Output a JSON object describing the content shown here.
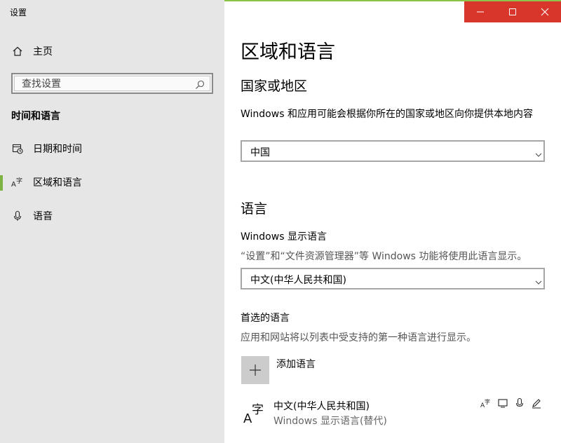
{
  "window": {
    "title": "设置"
  },
  "sidebar": {
    "home_label": "主页",
    "search_placeholder": "查找设置",
    "section_heading": "时间和语言",
    "items": [
      {
        "label": "日期和时间",
        "icon": "calendar-clock-icon"
      },
      {
        "label": "区域和语言",
        "icon": "language-icon",
        "selected": true
      },
      {
        "label": "语音",
        "icon": "microphone-icon"
      }
    ]
  },
  "main": {
    "title": "区域和语言",
    "country": {
      "heading": "国家或地区",
      "description": "Windows 和应用可能会根据你所在的国家或地区向你提供本地内容",
      "selected": "中国"
    },
    "language": {
      "heading": "语言",
      "display_label": "Windows 显示语言",
      "display_desc": "“设置”和“文件资源管理器”等 Windows 功能将使用此语言显示。",
      "display_selected": "中文(中华人民共和国)",
      "preferred_label": "首选的语言",
      "preferred_desc": "应用和网站将以列表中受支持的第一种语言进行显示。",
      "add_label": "添加语言",
      "list": [
        {
          "name": "中文(中华人民共和国)",
          "sub": "Windows 显示语言(替代)"
        }
      ]
    }
  },
  "colors": {
    "accent": "#7cb342",
    "close": "#d9362b",
    "sidebar_bg": "#e6e6e6"
  }
}
